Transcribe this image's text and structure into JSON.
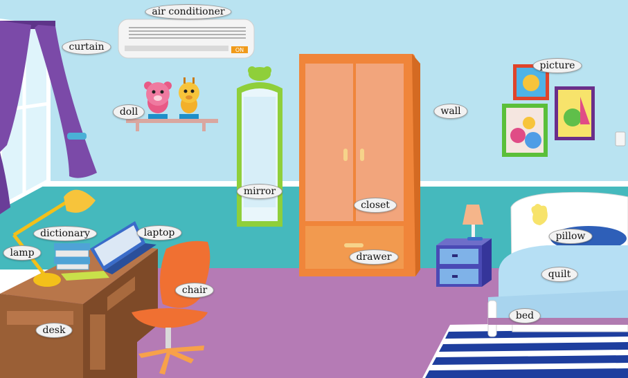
{
  "labels": {
    "air_conditioner": "air conditioner",
    "curtain": "curtain",
    "doll": "doll",
    "mirror": "mirror",
    "closet": "closet",
    "wall": "wall",
    "picture": "picture",
    "dictionary": "dictionary",
    "laptop": "laptop",
    "lamp": "lamp",
    "pillow": "pillow",
    "drawer": "drawer",
    "quilt": "quilt",
    "chair": "chair",
    "bed": "bed",
    "desk": "desk"
  },
  "ac_button": "ON",
  "colors": {
    "wall": "#b9e3f1",
    "wainscot": "#45b9bd",
    "floor": "#b57bb5",
    "closet": "#f0853a",
    "curtain": "#7b4aa8",
    "mirror_frame": "#8fcf3a"
  }
}
